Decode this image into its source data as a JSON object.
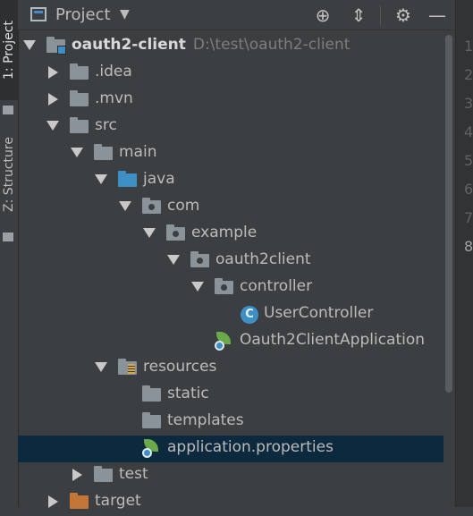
{
  "left_strip": {
    "project_tab": "1: Project",
    "structure_tab": "Z: Structure"
  },
  "header": {
    "title": "Project",
    "icons": [
      "window-icon",
      "caret-down-icon",
      "locate-icon",
      "collapse-all-icon",
      "gear-icon",
      "hide-icon"
    ]
  },
  "tree": {
    "root": {
      "name": "oauth2-client",
      "path": "D:\\test\\oauth2-client"
    },
    "items": [
      {
        "label": ".idea"
      },
      {
        "label": ".mvn"
      },
      {
        "label": "src"
      },
      {
        "label": "main"
      },
      {
        "label": "java"
      },
      {
        "label": "com"
      },
      {
        "label": "example"
      },
      {
        "label": "oauth2client"
      },
      {
        "label": "controller"
      },
      {
        "label": "UserController"
      },
      {
        "label": "Oauth2ClientApplication"
      },
      {
        "label": "resources"
      },
      {
        "label": "static"
      },
      {
        "label": "templates"
      },
      {
        "label": "application.properties"
      },
      {
        "label": "test"
      },
      {
        "label": "target"
      }
    ],
    "selected": "application.properties",
    "class_icon_letter": "C"
  },
  "gutter": {
    "line_numbers": [
      "1",
      "2",
      "3",
      "4",
      "5",
      "6",
      "7",
      "8"
    ],
    "active_line": "8"
  },
  "colors": {
    "panel_bg": "#3c3f41",
    "selection_bg": "#0d293e",
    "source_folder": "#3f8fc7",
    "excluded_folder": "#c47538",
    "spring_green": "#6aaa4a"
  }
}
